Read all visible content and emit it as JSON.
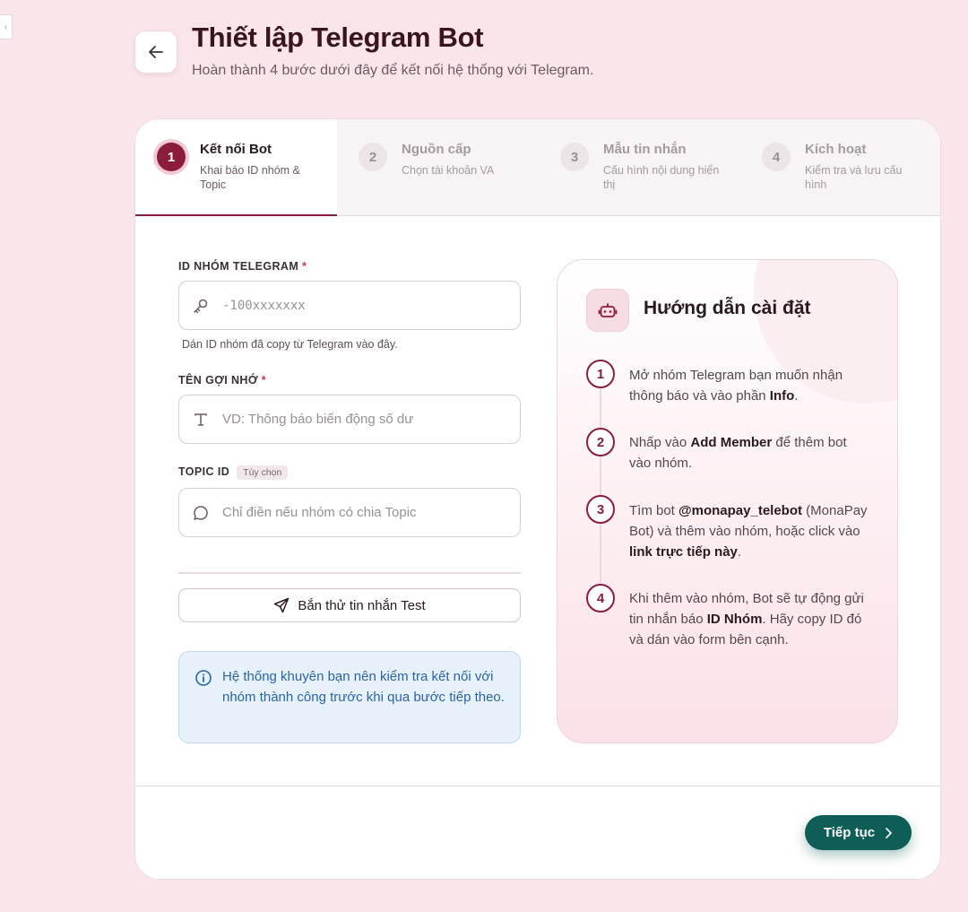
{
  "edge_tab_glyph": "‹",
  "header": {
    "title": "Thiết lập Telegram Bot",
    "subtitle": "Hoàn thành 4 bước dưới đây để kết nối hệ thống với Telegram."
  },
  "steps": [
    {
      "number": "1",
      "title": "Kết nối Bot",
      "desc": "Khai báo ID nhóm & Topic",
      "active": true
    },
    {
      "number": "2",
      "title": "Nguồn cấp",
      "desc": "Chọn tài khoản VA",
      "active": false
    },
    {
      "number": "3",
      "title": "Mẫu tin nhắn",
      "desc": "Cấu hình nội dung hiển thị",
      "active": false
    },
    {
      "number": "4",
      "title": "Kích hoạt",
      "desc": "Kiểm tra và lưu cấu hình",
      "active": false
    }
  ],
  "form": {
    "group_id": {
      "label": "ID NHÓM TELEGRAM",
      "required_mark": "*",
      "placeholder": "-100xxxxxxx",
      "value": "",
      "hint": "Dán ID nhóm đã copy từ Telegram vào đây."
    },
    "nickname": {
      "label": "TÊN GỢI NHỚ",
      "required_mark": "*",
      "placeholder": "VD: Thông báo biến động số dư",
      "value": ""
    },
    "topic_id": {
      "label": "TOPIC ID",
      "optional_badge": "Tùy chọn",
      "placeholder": "Chỉ điền nếu nhóm có chia Topic",
      "value": ""
    },
    "test_button": "Bắn thử tin nhắn Test",
    "info": "Hệ thống khuyên bạn nên kiểm tra kết nối với nhóm thành công trước khi qua bước tiếp theo."
  },
  "guide": {
    "title": "Hướng dẫn cài đặt",
    "steps": [
      {
        "number": "1",
        "pre": "Mở nhóm Telegram bạn muốn nhận thông báo và vào phần ",
        "b1": "Info",
        "mid": ".",
        "b2": "",
        "post": ""
      },
      {
        "number": "2",
        "pre": "Nhấp vào ",
        "b1": "Add Member",
        "mid": " để thêm bot vào nhóm.",
        "b2": "",
        "post": ""
      },
      {
        "number": "3",
        "pre": "Tìm bot ",
        "b1": "@monapay_telebot",
        "mid": " (MonaPay Bot) và thêm vào nhóm, hoặc click vào ",
        "b2": "link trực tiếp này",
        "post": "."
      },
      {
        "number": "4",
        "pre": "Khi thêm vào nhóm, Bot sẽ tự động gửi tin nhắn báo ",
        "b1": "ID Nhóm",
        "mid": ". Hãy copy ID đó và dán vào form bên cạnh.",
        "b2": "",
        "post": ""
      }
    ]
  },
  "footer": {
    "next_button": "Tiếp tục"
  },
  "colors": {
    "accent": "#8b1d3a",
    "primary_button": "#0e5d57",
    "info": "#2a64a8",
    "background": "#f9e5ea"
  }
}
